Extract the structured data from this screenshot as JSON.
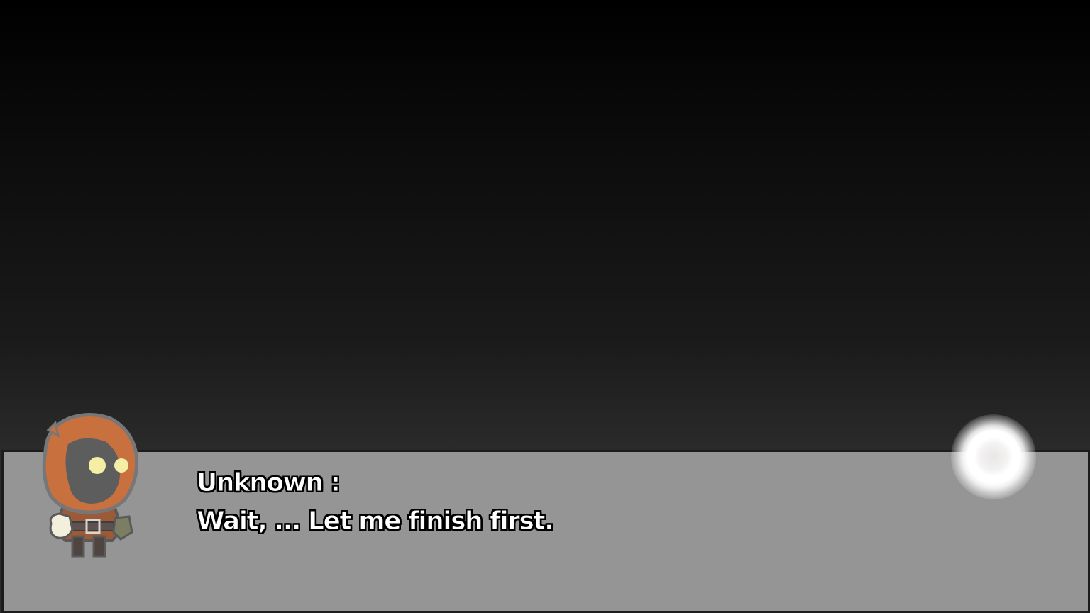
{
  "dialog": {
    "speaker": "Unknown :",
    "text": "Wait, ... Let me finish first."
  },
  "portrait": {
    "icon": "hooded-character-portrait-icon"
  },
  "advance_indicator": {
    "icon": "glowing-orb-icon"
  },
  "colors": {
    "dialog_background": "#959595",
    "hood": "#c9703f",
    "eyes": "#f4efa4",
    "text": "#ffffff",
    "text_outline": "#000000"
  }
}
